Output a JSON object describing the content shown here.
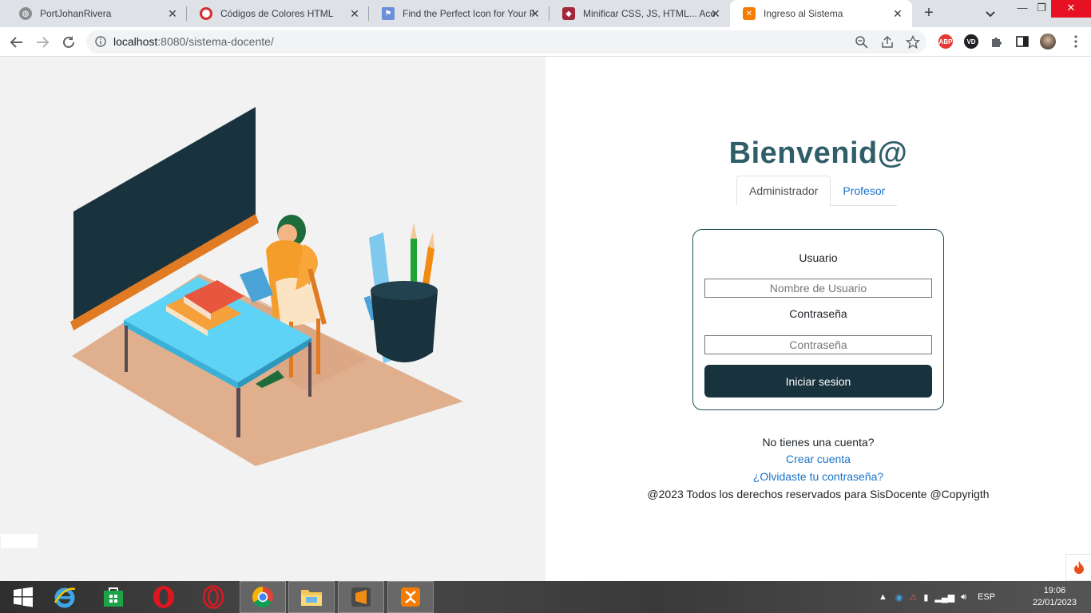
{
  "browser": {
    "tabs": [
      {
        "title": "PortJohanRivera",
        "favicon": "globe-icon",
        "active": false
      },
      {
        "title": "Códigos de Colores HTML",
        "favicon": "red-circle-icon",
        "active": false
      },
      {
        "title": "Find the Perfect Icon for Your P",
        "favicon": "flag-icon",
        "active": false
      },
      {
        "title": "Minificar CSS, JS, HTML... Acele",
        "favicon": "minify-icon",
        "active": false
      },
      {
        "title": "Ingreso al Sistema",
        "favicon": "xampp-icon",
        "active": true
      }
    ],
    "url_host": "localhost",
    "url_rest": ":8080/sistema-docente/",
    "extensions": [
      "abp-icon",
      "vd-icon",
      "puzzle-icon",
      "sidepanel-icon",
      "profile-avatar"
    ]
  },
  "page": {
    "welcome": "Bienvenid@",
    "role_tabs": [
      "Administrador",
      "Profesor"
    ],
    "form": {
      "user_label": "Usuario",
      "user_placeholder": "Nombre de Usuario",
      "password_label": "Contraseña",
      "password_placeholder": "Contraseña",
      "submit": "Iniciar sesion"
    },
    "footer": {
      "no_account": "No tienes una cuenta?",
      "create_account": "Crear cuenta",
      "forgot": "¿Olvidaste tu contraseña?",
      "copyright": "@2023 Todos los derechos reservados para SisDocente @Copyrigth"
    },
    "colors": {
      "title": "#2f5e68",
      "button": "#19333e",
      "link": "#1a73c8",
      "left_bg": "#f2f2f2"
    }
  },
  "taskbar": {
    "apps": [
      "windows-start-icon",
      "internet-explorer-icon",
      "store-icon",
      "opera-icon",
      "opera-gx-icon",
      "chrome-icon",
      "file-explorer-icon",
      "sublime-text-icon",
      "xampp-icon"
    ],
    "language": "ESP",
    "time": "19:06",
    "date": "22/01/2023"
  }
}
